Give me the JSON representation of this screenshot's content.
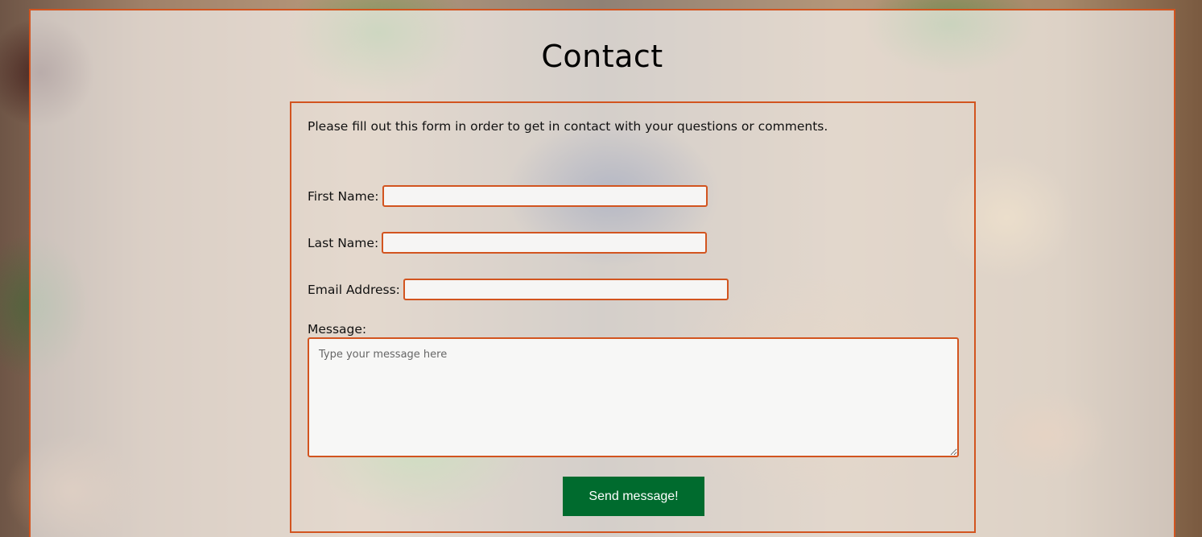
{
  "page": {
    "title": "Contact"
  },
  "form": {
    "intro": "Please fill out this form in order to get in contact with your questions or comments.",
    "first_name_label": "First Name:",
    "first_name_value": "",
    "last_name_label": "Last Name:",
    "last_name_value": "",
    "email_label": "Email Address:",
    "email_value": "",
    "message_label": "Message:",
    "message_placeholder": "Type your message here",
    "submit_label": "Send message!"
  },
  "colors": {
    "accent_border": "#d2541f",
    "button_bg": "#006b2e",
    "button_text": "#ffffff"
  }
}
